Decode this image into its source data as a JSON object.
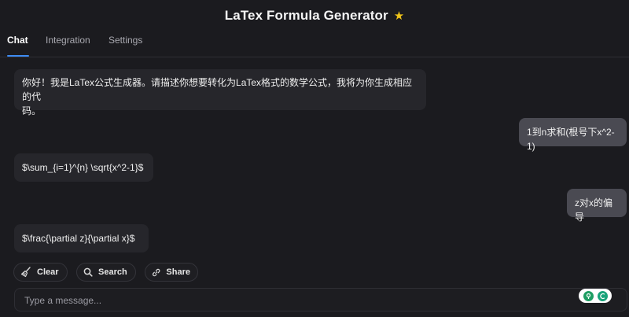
{
  "header": {
    "title": "LaTex Formula Generator",
    "star_icon": "star-icon",
    "star_color": "#f0c419"
  },
  "tabs": [
    {
      "label": "Chat",
      "active": true
    },
    {
      "label": "Integration",
      "active": false
    },
    {
      "label": "Settings",
      "active": false
    }
  ],
  "messages": [
    {
      "role": "bot",
      "line1": "你好！我是LaTex公式生成器。请描述你想要转化为LaTex格式的数学公式，我将为你生成相应的代",
      "line2": "码。"
    },
    {
      "role": "user",
      "text": "1到n求和(根号下x^2-1)"
    },
    {
      "role": "bot",
      "text": "$\\sum_{i=1}^{n} \\sqrt{x^2-1}$"
    },
    {
      "role": "user",
      "text": "z对x的偏导"
    },
    {
      "role": "bot",
      "text": "$\\frac{\\partial z}{\\partial x}$"
    }
  ],
  "actions": {
    "clear_label": "Clear",
    "search_label": "Search",
    "share_label": "Share"
  },
  "input": {
    "placeholder": "Type a message...",
    "value": ""
  },
  "colors": {
    "accent": "#3d8bf2",
    "background": "#1b1b1f",
    "user_bubble": "#4a4a52",
    "bot_bubble": "#26262b"
  }
}
